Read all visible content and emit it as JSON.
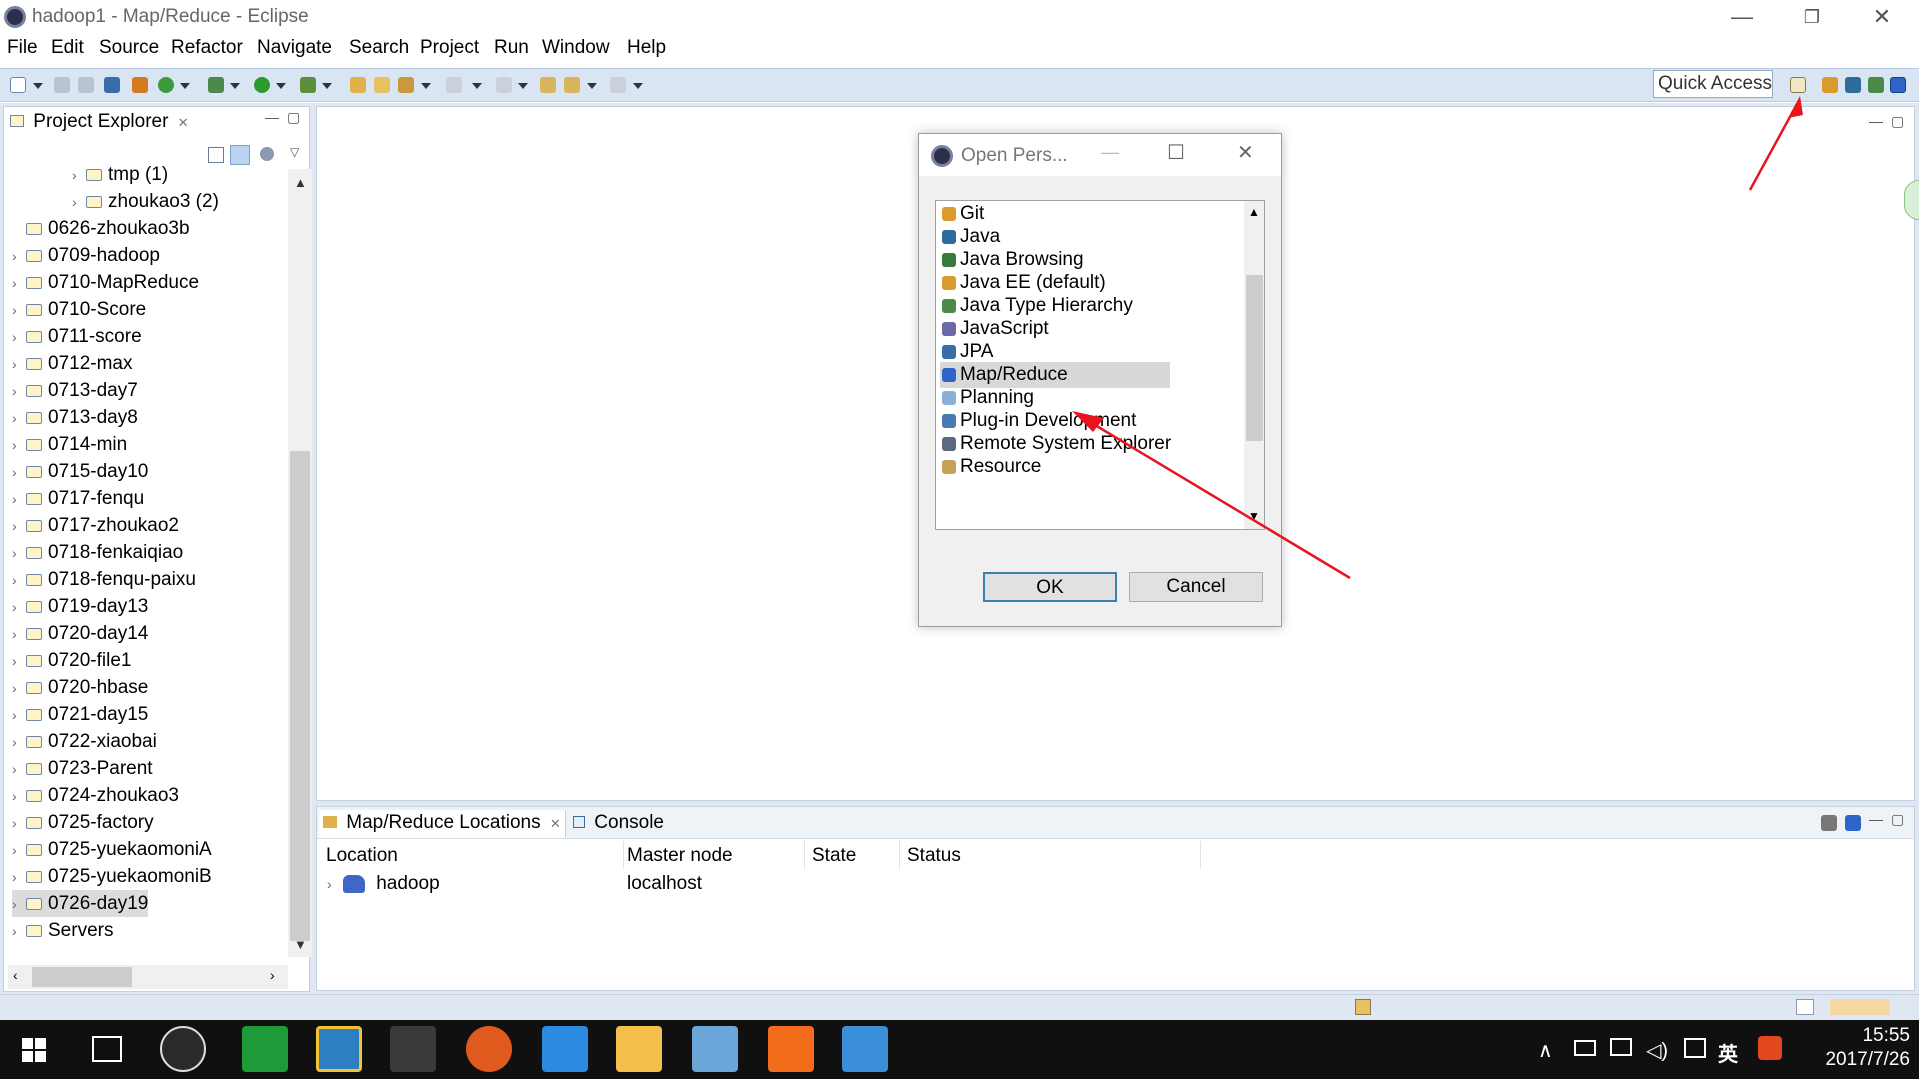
{
  "window": {
    "title": "hadoop1 - Map/Reduce - Eclipse",
    "minimize": "—",
    "restore": "❐",
    "close": "✕"
  },
  "menu": [
    "File",
    "Edit",
    "Source",
    "Refactor",
    "Navigate",
    "Search",
    "Project",
    "Run",
    "Window",
    "Help"
  ],
  "toolbar": {
    "quick_access": "Quick Access"
  },
  "explorer": {
    "tab_label": "Project Explorer",
    "tree": [
      {
        "label": "tmp (1)",
        "indent": 2
      },
      {
        "label": "zhoukao3 (2)",
        "indent": 2
      },
      {
        "label": "0626-zhoukao3b",
        "indent": 0
      },
      {
        "label": "0709-hadoop",
        "indent": 0
      },
      {
        "label": "0710-MapReduce",
        "indent": 0
      },
      {
        "label": "0710-Score",
        "indent": 0
      },
      {
        "label": "0711-score",
        "indent": 0
      },
      {
        "label": "0712-max",
        "indent": 0
      },
      {
        "label": "0713-day7",
        "indent": 0
      },
      {
        "label": "0713-day8",
        "indent": 0
      },
      {
        "label": "0714-min",
        "indent": 0
      },
      {
        "label": "0715-day10",
        "indent": 0
      },
      {
        "label": "0717-fenqu",
        "indent": 0
      },
      {
        "label": "0717-zhoukao2",
        "indent": 0
      },
      {
        "label": "0718-fenkaiqiao",
        "indent": 0
      },
      {
        "label": "0718-fenqu-paixu",
        "indent": 0
      },
      {
        "label": "0719-day13",
        "indent": 0
      },
      {
        "label": "0720-day14",
        "indent": 0
      },
      {
        "label": "0720-file1",
        "indent": 0
      },
      {
        "label": "0720-hbase",
        "indent": 0
      },
      {
        "label": "0721-day15",
        "indent": 0
      },
      {
        "label": "0722-xiaobai",
        "indent": 0
      },
      {
        "label": "0723-Parent",
        "indent": 0
      },
      {
        "label": "0724-zhoukao3",
        "indent": 0
      },
      {
        "label": "0725-factory",
        "indent": 0
      },
      {
        "label": "0725-yuekaomoniA",
        "indent": 0
      },
      {
        "label": "0725-yuekaomoniB",
        "indent": 0
      },
      {
        "label": "0726-day19",
        "indent": 0,
        "selected": true
      },
      {
        "label": "Servers",
        "indent": 0
      }
    ]
  },
  "bottom_panel": {
    "tab_mapreduce": "Map/Reduce Locations",
    "tab_console": "Console",
    "columns": [
      "Location",
      "Master node",
      "State",
      "Status"
    ],
    "rows": [
      {
        "location": "hadoop",
        "master": "localhost",
        "state": "",
        "status": ""
      }
    ]
  },
  "dialog": {
    "title": "Open Pers...",
    "perspectives": [
      "Git",
      "Java",
      "Java Browsing",
      "Java EE (default)",
      "Java Type Hierarchy",
      "JavaScript",
      "JPA",
      "Map/Reduce",
      "Planning",
      "Plug-in Development",
      "Remote System Explorer",
      "Resource"
    ],
    "selected": "Map/Reduce",
    "ok_label": "OK",
    "cancel_label": "Cancel"
  },
  "taskbar": {
    "ime": "英",
    "time": "15:55",
    "date": "2017/7/26"
  },
  "colors": {
    "toolbar_bg": "#d9e5f2",
    "annotation_arrow": "#e8141e",
    "selection": "#d8d8d8"
  }
}
